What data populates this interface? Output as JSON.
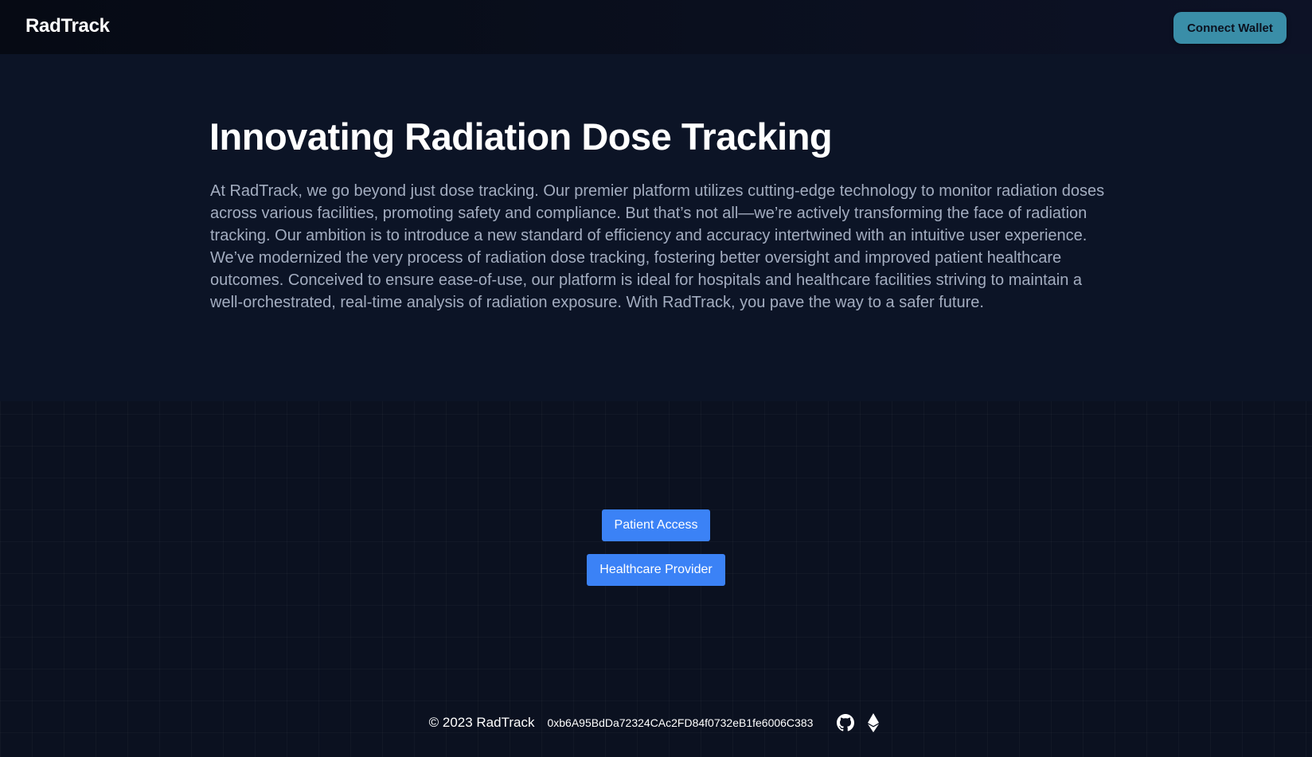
{
  "header": {
    "logo": "RadTrack",
    "connect_wallet_label": "Connect Wallet"
  },
  "hero": {
    "title": "Innovating Radiation Dose Tracking",
    "body": "At RadTrack, we go beyond just dose tracking. Our premier platform utilizes cutting-edge technology to monitor radiation doses across various facilities, promoting safety and compliance. But that’s not all—we’re actively transforming the face of radiation tracking. Our ambition is to introduce a new standard of efficiency and accuracy intertwined with an intuitive user experience. We’ve modernized the very process of radiation dose tracking, fostering better oversight and improved patient healthcare outcomes. Conceived to ensure ease-of-use, our platform is ideal for hospitals and healthcare facilities striving to maintain a well-orchestrated, real-time analysis of radiation exposure. With RadTrack, you pave the way to a safer future."
  },
  "actions": {
    "patient_access_label": "Patient Access",
    "healthcare_provider_label": "Healthcare Provider"
  },
  "footer": {
    "copyright": "© 2023 RadTrack",
    "wallet_address": "0xb6A95BdDa72324CAc2FD84f0732eB1fe6006C383",
    "icons": [
      "github-icon",
      "ethereum-icon"
    ]
  },
  "colors": {
    "background": "#0b1120",
    "hero_background": "#0c1426",
    "accent_button": "#3a8ea8",
    "primary_button": "#3b82f6",
    "body_text": "#a3adc0",
    "heading_text": "#ffffff"
  }
}
